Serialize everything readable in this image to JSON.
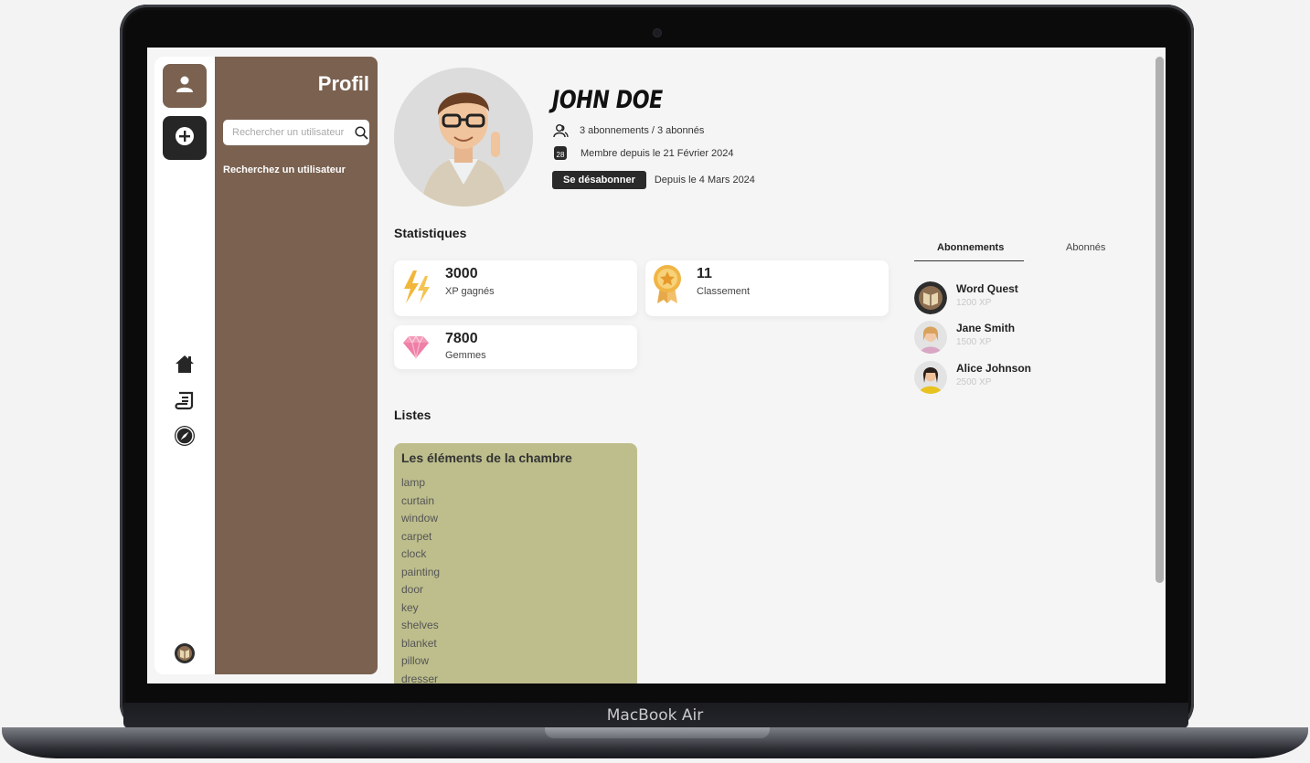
{
  "device": {
    "brand_label": "MacBook Air"
  },
  "sidebar": {
    "rail_icons": [
      "user-icon",
      "plus-circle-icon",
      "home-icon",
      "scroll-icon",
      "compass-icon",
      "logo-icon"
    ]
  },
  "panel": {
    "title": "Profil",
    "search_placeholder": "Rechercher un utilisateur",
    "hint": "Recherchez un utilisateur"
  },
  "profile": {
    "name": "JOHN DOE",
    "follow_counts": "3 abonnements / 3 abonnés",
    "member_since": "Membre depuis le 21 Février 2024",
    "calendar_day": "28",
    "unsubscribe_label": "Se désabonner",
    "subscribed_since": "Depuis le 4 Mars 2024"
  },
  "stats": {
    "title": "Statistiques",
    "xp": {
      "value": "3000",
      "label": "XP gagnés"
    },
    "rank": {
      "value": "11",
      "label": "Classement"
    },
    "gems": {
      "value": "7800",
      "label": "Gemmes"
    }
  },
  "lists": {
    "title": "Listes",
    "cards": [
      {
        "title": "Les éléments de la chambre",
        "items": [
          "lamp",
          "curtain",
          "window",
          "carpet",
          "clock",
          "painting",
          "door",
          "key",
          "shelves",
          "blanket",
          "pillow",
          "dresser"
        ]
      }
    ]
  },
  "follows": {
    "tabs": [
      "Abonnements",
      "Abonnés"
    ],
    "active_tab": "Abonnements",
    "items": [
      {
        "name": "Word Quest",
        "xp": "1200 XP"
      },
      {
        "name": "Jane Smith",
        "xp": "1500 XP"
      },
      {
        "name": "Alice Johnson",
        "xp": "2500 XP"
      }
    ]
  },
  "colors": {
    "panel_brown": "#7a6150",
    "dark_button": "#262626",
    "list_card": "#bdbe8c",
    "background": "#f5f5f5"
  }
}
